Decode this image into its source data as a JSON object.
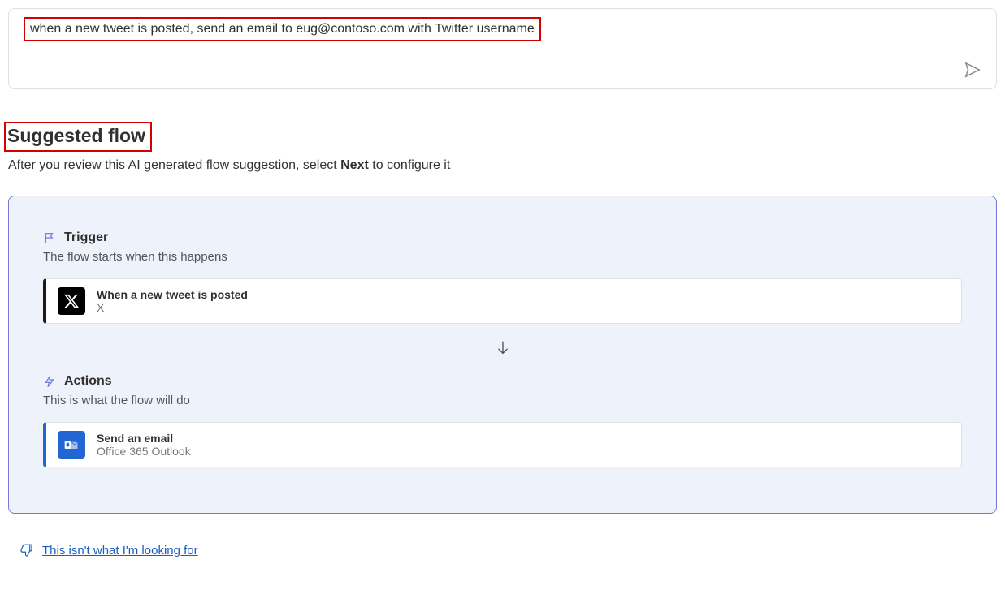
{
  "input": {
    "prompt_text": "when a new tweet is posted, send an email to eug@contoso.com with Twitter username"
  },
  "suggested": {
    "heading": "Suggested flow",
    "subtext_before": "After you review this AI generated flow suggestion, select ",
    "subtext_bold": "Next",
    "subtext_after": " to configure it"
  },
  "trigger": {
    "label": "Trigger",
    "desc": "The flow starts when this happens",
    "step_title": "When a new tweet is posted",
    "step_sub": "X"
  },
  "actions": {
    "label": "Actions",
    "desc": "This is what the flow will do",
    "step_title": "Send an email",
    "step_sub": "Office 365 Outlook"
  },
  "feedback": {
    "link_text": "This isn't what I'm looking for"
  }
}
